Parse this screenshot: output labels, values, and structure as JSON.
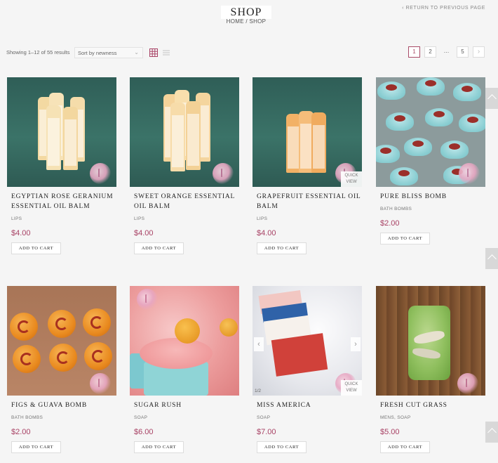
{
  "header": {
    "title": "SHOP",
    "breadcrumb": "HOME / SHOP",
    "return_link": "‹ RETURN TO PREVIOUS PAGE"
  },
  "toolbar": {
    "result_count": "Showing 1–12 of 55 results",
    "sort_selected": "Sort by newness",
    "pagination": [
      "1",
      "2",
      "…",
      "5",
      "›"
    ],
    "active_page": "1"
  },
  "products": [
    {
      "name": "Egyptian Rose Geranium Essential Oil Balm",
      "category": "LIPS",
      "price": "$4.00",
      "button": "ADD TO CART"
    },
    {
      "name": "Sweet Orange Essential Oil Balm",
      "category": "LIPS",
      "price": "$4.00",
      "button": "ADD TO CART"
    },
    {
      "name": "Grapefruit Essential Oil Balm",
      "category": "LIPS",
      "price": "$4.00",
      "button": "ADD TO CART",
      "overlay": "QUICK VIEW"
    },
    {
      "name": "Pure Bliss Bomb",
      "category": "BATH BOMBS",
      "price": "$2.00",
      "button": "ADD TO CART"
    },
    {
      "name": "Figs & Guava Bomb",
      "category": "BATH BOMBS",
      "price": "$2.00",
      "button": "ADD TO CART"
    },
    {
      "name": "Sugar Rush",
      "category": "SOAP",
      "price": "$6.00",
      "button": "ADD TO CART"
    },
    {
      "name": "Miss America",
      "category": "SOAP",
      "price": "$7.00",
      "button": "ADD TO CART",
      "overlay": "QUICK VIEW",
      "slide_count": "1/2"
    },
    {
      "name": "Fresh Cut Grass",
      "category": "MENS, SOAP",
      "price": "$5.00",
      "button": "ADD TO CART"
    }
  ],
  "colors": {
    "accent": "#a84265",
    "background": "#f5f5f5"
  }
}
